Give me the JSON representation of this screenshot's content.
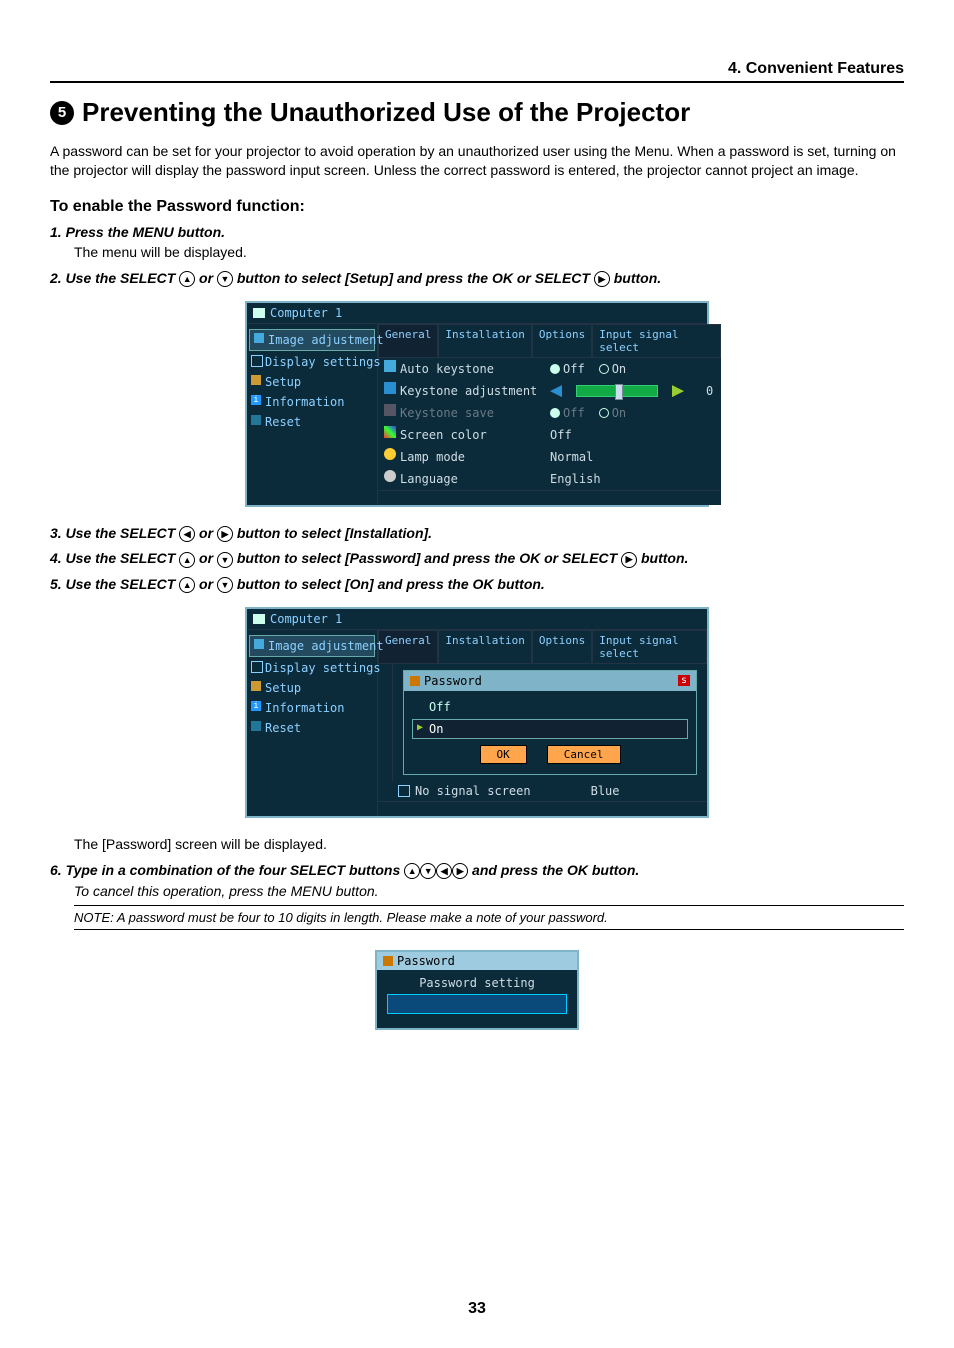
{
  "chapter": "4. Convenient Features",
  "section_number": "5",
  "section_title": "Preventing the Unauthorized Use of the Projector",
  "intro": "A password can be set for your projector to avoid operation by an unauthorized user using the Menu. When a password is set, turning on the projector will display the password input screen. Unless the correct password is entered, the projector cannot project an image.",
  "subhead": "To enable the Password function:",
  "page_number": "33",
  "step1": {
    "text_a": "1.  Press the MENU button.",
    "sub": "The menu will be displayed."
  },
  "step2": {
    "prefix": "2.  Use the SELECT ",
    "mid": " or ",
    "tail": " button to select [Setup] and press the OK or SELECT ",
    "end": " button."
  },
  "step3": {
    "prefix": "3.  Use the SELECT ",
    "mid": " or ",
    "tail": " button to select [Installation]."
  },
  "step4": {
    "prefix": "4.  Use the SELECT ",
    "mid": " or ",
    "tail": " button to select  [Password] and press the OK or SELECT ",
    "end": " button."
  },
  "step5": {
    "prefix": "5.  Use the SELECT ",
    "mid": " or ",
    "tail": " button to select [On] and press the OK button."
  },
  "caption5": "The [Password] screen will be displayed.",
  "step6": {
    "prefix": "6.  Type in a combination of the four SELECT buttons  ",
    "tail": " and press the OK button."
  },
  "cancel_note": "To cancel this operation, press the MENU button.",
  "note": "NOTE: A password must be four to 10  digits in length. Please make a note of your password.",
  "osd_title": "Computer 1",
  "nav_items": [
    "Image adjustment",
    "Display settings",
    "Setup",
    "Information",
    "Reset"
  ],
  "tabs": [
    "General",
    "Installation",
    "Options",
    "Input signal select"
  ],
  "osd1_rows": {
    "auto_keystone": {
      "label": "Auto keystone",
      "off": "Off",
      "on": "On"
    },
    "keystone_adj": {
      "label": "Keystone adjustment",
      "value": "0"
    },
    "keystone_save": {
      "label": "Keystone save",
      "off": "Off",
      "on": "On"
    },
    "screen_color": {
      "label": "Screen color",
      "value": "Off"
    },
    "lamp_mode": {
      "label": "Lamp mode",
      "value": "Normal"
    },
    "language": {
      "label": "Language",
      "value": "English"
    }
  },
  "osd2_popup": {
    "title": "Password",
    "badge": "s",
    "opt_off": "Off",
    "opt_on": "On",
    "btn_ok": "OK",
    "btn_cancel": "Cancel"
  },
  "osd2_extra": {
    "label": "No signal screen",
    "value": "Blue"
  },
  "pwd_dialog": {
    "title": "Password",
    "label": "Password setting"
  }
}
